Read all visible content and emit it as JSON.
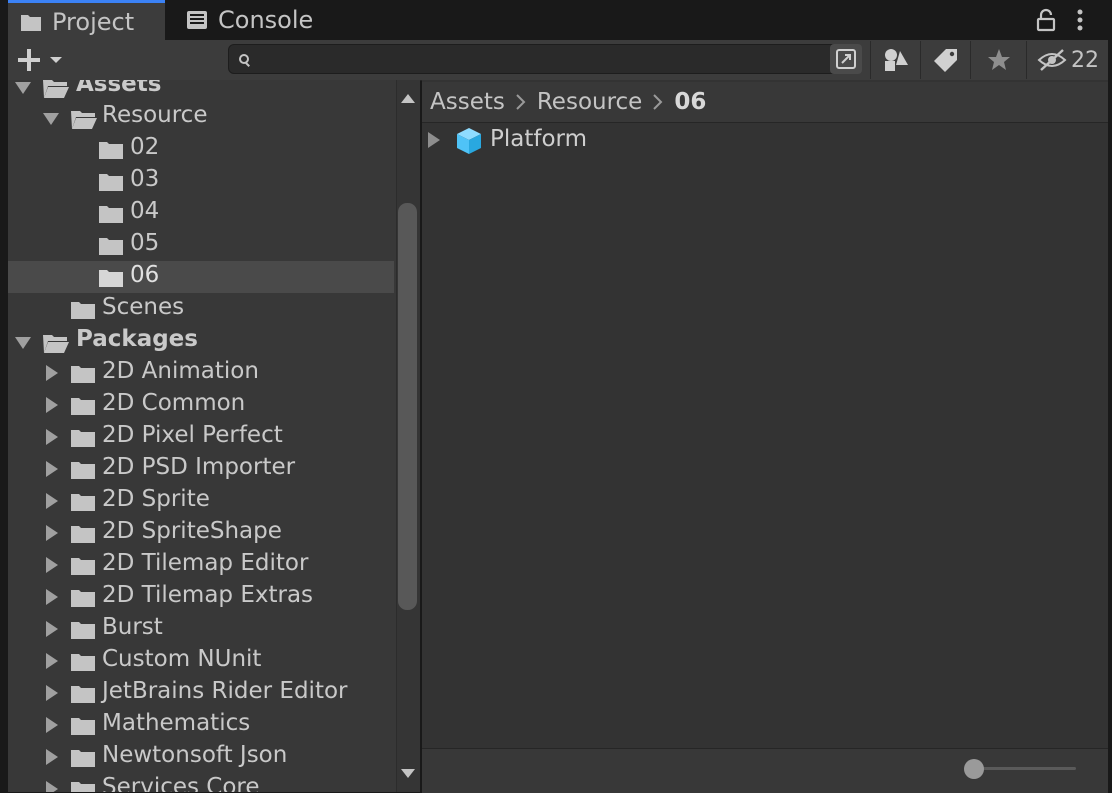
{
  "tabs": [
    {
      "label": "Project",
      "icon": "folder-icon",
      "active": true
    },
    {
      "label": "Console",
      "icon": "console-icon",
      "active": false
    }
  ],
  "toolbar": {
    "search_placeholder": "",
    "hidden_count": "22"
  },
  "tree": {
    "assets": {
      "label": "Assets"
    },
    "resource": {
      "label": "Resource"
    },
    "resource_children": [
      "02",
      "03",
      "04",
      "05",
      "06"
    ],
    "scenes": {
      "label": "Scenes"
    },
    "packages": {
      "label": "Packages"
    },
    "packages_children": [
      "2D Animation",
      "2D Common",
      "2D Pixel Perfect",
      "2D PSD Importer",
      "2D Sprite",
      "2D SpriteShape",
      "2D Tilemap Editor",
      "2D Tilemap Extras",
      "Burst",
      "Custom NUnit",
      "JetBrains Rider Editor",
      "Mathematics",
      "Newtonsoft Json",
      "Services Core"
    ],
    "selected": "06"
  },
  "breadcrumb": [
    "Assets",
    "Resource",
    "06"
  ],
  "content": {
    "items": [
      {
        "label": "Platform",
        "icon": "prefab-cube-icon"
      }
    ]
  },
  "colors": {
    "accent": "#3b82f6",
    "selection": "#4a4a4a",
    "prefab": "#4fc3f7"
  }
}
